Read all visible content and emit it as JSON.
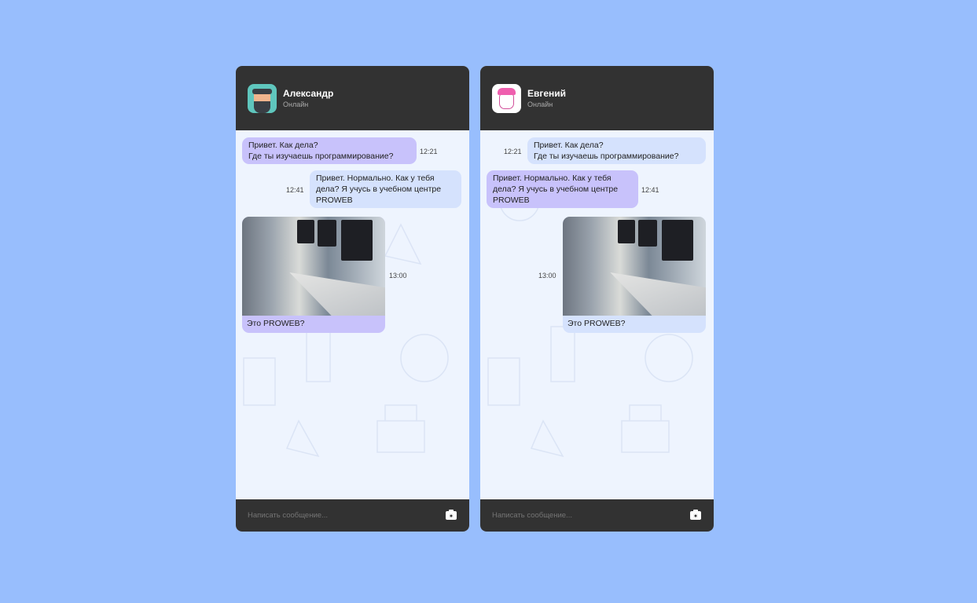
{
  "colors": {
    "background": "#98befd",
    "header": "#323232",
    "chat_bg": "#eef4fe",
    "bubble_purple": "#c8c2fb",
    "bubble_blue": "#d5e2fd"
  },
  "chats": [
    {
      "contact": {
        "name": "Александр",
        "status": "Онлайн",
        "avatar": "bearded-man-avatar"
      },
      "messages": [
        {
          "text": "Привет. Как дела?\nГде ты изучаешь программирование?",
          "time": "12:21"
        },
        {
          "text": "Привет. Нормально. Как у тебя дела? Я учусь в учебном центре PROWEB",
          "time": "12:41"
        },
        {
          "caption": "Это PROWEB?",
          "time": "13:00",
          "image": "computer-lab-photo"
        }
      ],
      "input_placeholder": "Написать сообщение...",
      "camera_icon": "camera-icon"
    },
    {
      "contact": {
        "name": "Евгений",
        "status": "Онлайн",
        "avatar": "pink-hair-avatar"
      },
      "messages": [
        {
          "text": "Привет. Как дела?\nГде ты изучаешь программирование?",
          "time": "12:21"
        },
        {
          "text": "Привет. Нормально. Как у тебя дела? Я учусь в учебном центре PROWEB",
          "time": "12:41"
        },
        {
          "caption": "Это PROWEB?",
          "time": "13:00",
          "image": "computer-lab-photo"
        }
      ],
      "input_placeholder": "Написать сообщение...",
      "camera_icon": "camera-icon"
    }
  ]
}
